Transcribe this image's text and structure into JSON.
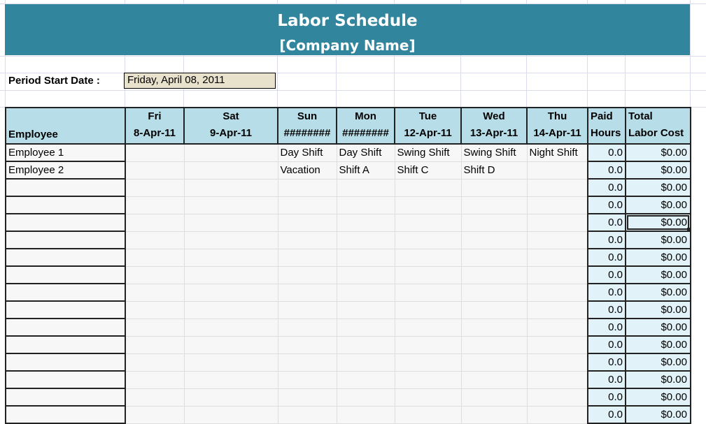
{
  "sheet": {
    "title": "Labor Schedule",
    "company": "[Company Name]",
    "colors": {
      "banner": "#31869e",
      "header_fill": "#b7dee8",
      "total_fill": "#e1f2f8",
      "period_fill": "#e8e2cc"
    }
  },
  "period": {
    "label": "Period Start Date :",
    "value": "Friday, April 08, 2011"
  },
  "table": {
    "columns": [
      {
        "key": "employee",
        "day": "",
        "date": "Employee"
      },
      {
        "key": "fri",
        "day": "Fri",
        "date": "8-Apr-11"
      },
      {
        "key": "sat",
        "day": "Sat",
        "date": "9-Apr-11"
      },
      {
        "key": "sun",
        "day": "Sun",
        "date": "########"
      },
      {
        "key": "mon",
        "day": "Mon",
        "date": "########"
      },
      {
        "key": "tue",
        "day": "Tue",
        "date": "12-Apr-11"
      },
      {
        "key": "wed",
        "day": "Wed",
        "date": "13-Apr-11"
      },
      {
        "key": "thu",
        "day": "Thu",
        "date": "14-Apr-11"
      },
      {
        "key": "paid",
        "day": "Paid",
        "date": "Hours"
      },
      {
        "key": "total",
        "day": "Total",
        "date": "Labor Cost"
      }
    ],
    "rows": [
      {
        "employee": "Employee 1",
        "fri": "",
        "sat": "",
        "sun": "Day Shift",
        "mon": "Day Shift",
        "tue": "Swing Shift",
        "wed": "Swing Shift",
        "thu": "Night Shift",
        "paid": "0.0",
        "total": "$0.00"
      },
      {
        "employee": "Employee 2",
        "fri": "",
        "sat": "",
        "sun": "Vacation",
        "mon": "Shift A",
        "tue": "Shift C",
        "wed": "Shift  D",
        "thu": "",
        "paid": "0.0",
        "total": "$0.00"
      },
      {
        "employee": "",
        "fri": "",
        "sat": "",
        "sun": "",
        "mon": "",
        "tue": "",
        "wed": "",
        "thu": "",
        "paid": "0.0",
        "total": "$0.00"
      },
      {
        "employee": "",
        "fri": "",
        "sat": "",
        "sun": "",
        "mon": "",
        "tue": "",
        "wed": "",
        "thu": "",
        "paid": "0.0",
        "total": "$0.00"
      },
      {
        "employee": "",
        "fri": "",
        "sat": "",
        "sun": "",
        "mon": "",
        "tue": "",
        "wed": "",
        "thu": "",
        "paid": "0.0",
        "total": "$0.00"
      },
      {
        "employee": "",
        "fri": "",
        "sat": "",
        "sun": "",
        "mon": "",
        "tue": "",
        "wed": "",
        "thu": "",
        "paid": "0.0",
        "total": "$0.00"
      },
      {
        "employee": "",
        "fri": "",
        "sat": "",
        "sun": "",
        "mon": "",
        "tue": "",
        "wed": "",
        "thu": "",
        "paid": "0.0",
        "total": "$0.00"
      },
      {
        "employee": "",
        "fri": "",
        "sat": "",
        "sun": "",
        "mon": "",
        "tue": "",
        "wed": "",
        "thu": "",
        "paid": "0.0",
        "total": "$0.00"
      },
      {
        "employee": "",
        "fri": "",
        "sat": "",
        "sun": "",
        "mon": "",
        "tue": "",
        "wed": "",
        "thu": "",
        "paid": "0.0",
        "total": "$0.00"
      },
      {
        "employee": "",
        "fri": "",
        "sat": "",
        "sun": "",
        "mon": "",
        "tue": "",
        "wed": "",
        "thu": "",
        "paid": "0.0",
        "total": "$0.00"
      },
      {
        "employee": "",
        "fri": "",
        "sat": "",
        "sun": "",
        "mon": "",
        "tue": "",
        "wed": "",
        "thu": "",
        "paid": "0.0",
        "total": "$0.00"
      },
      {
        "employee": "",
        "fri": "",
        "sat": "",
        "sun": "",
        "mon": "",
        "tue": "",
        "wed": "",
        "thu": "",
        "paid": "0.0",
        "total": "$0.00"
      },
      {
        "employee": "",
        "fri": "",
        "sat": "",
        "sun": "",
        "mon": "",
        "tue": "",
        "wed": "",
        "thu": "",
        "paid": "0.0",
        "total": "$0.00"
      },
      {
        "employee": "",
        "fri": "",
        "sat": "",
        "sun": "",
        "mon": "",
        "tue": "",
        "wed": "",
        "thu": "",
        "paid": "0.0",
        "total": "$0.00"
      },
      {
        "employee": "",
        "fri": "",
        "sat": "",
        "sun": "",
        "mon": "",
        "tue": "",
        "wed": "",
        "thu": "",
        "paid": "0.0",
        "total": "$0.00"
      },
      {
        "employee": "",
        "fri": "",
        "sat": "",
        "sun": "",
        "mon": "",
        "tue": "",
        "wed": "",
        "thu": "",
        "paid": "0.0",
        "total": "$0.00"
      }
    ],
    "selected_cell": {
      "row": 4,
      "col": "total"
    }
  }
}
